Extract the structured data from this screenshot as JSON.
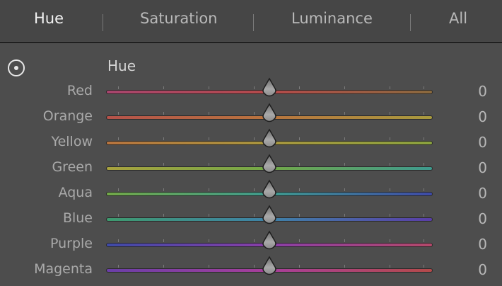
{
  "tabs": [
    {
      "label": "Hue",
      "active": true
    },
    {
      "label": "Saturation",
      "active": false
    },
    {
      "label": "Luminance",
      "active": false
    },
    {
      "label": "All",
      "active": false
    }
  ],
  "target_tool_icon": "target-adjustment-icon",
  "section": {
    "title": "Hue",
    "sliders": [
      {
        "label": "Red",
        "value": "0",
        "gradient": [
          "#a8456e",
          "#b44a4a",
          "#8a6a3e"
        ]
      },
      {
        "label": "Orange",
        "value": "0",
        "gradient": [
          "#b5524a",
          "#b8743e",
          "#a89a3e"
        ]
      },
      {
        "label": "Yellow",
        "value": "0",
        "gradient": [
          "#b8743e",
          "#a8963e",
          "#8aa23e"
        ]
      },
      {
        "label": "Green",
        "value": "0",
        "gradient": [
          "#a8a23e",
          "#72a848",
          "#3e9a8e"
        ]
      },
      {
        "label": "Aqua",
        "value": "0",
        "gradient": [
          "#72a848",
          "#3e9a8e",
          "#3e4aa8"
        ]
      },
      {
        "label": "Blue",
        "value": "0",
        "gradient": [
          "#3e9a6e",
          "#3e82a8",
          "#5a3ea8"
        ]
      },
      {
        "label": "Purple",
        "value": "0",
        "gradient": [
          "#3e4aa8",
          "#8a3ea8",
          "#b4486a"
        ]
      },
      {
        "label": "Magenta",
        "value": "0",
        "gradient": [
          "#6a3ea8",
          "#a83e9a",
          "#b44a4a"
        ]
      }
    ]
  }
}
